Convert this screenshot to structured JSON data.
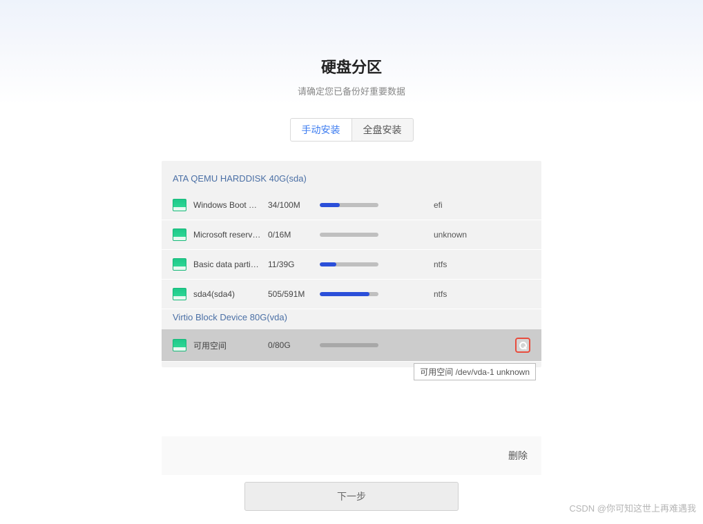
{
  "header": {
    "title": "硬盘分区",
    "subtitle": "请确定您已备份好重要数据"
  },
  "tabs": {
    "manual": "手动安装",
    "full": "全盘安装"
  },
  "disks": [
    {
      "label": "ATA  QEMU  HARDDISK  40G(sda)",
      "partitions": [
        {
          "name": "Windows Boot …",
          "size": "34/100M",
          "progress": 34,
          "fs": "efi"
        },
        {
          "name": "Microsoft reserv…",
          "size": "0/16M",
          "progress": 0,
          "fs": "unknown"
        },
        {
          "name": "Basic  data  parti…",
          "size": "11/39G",
          "progress": 28,
          "fs": "ntfs"
        },
        {
          "name": "sda4(sda4)",
          "size": "505/591M",
          "progress": 85,
          "fs": "ntfs"
        }
      ]
    },
    {
      "label": "Virtio  Block  Device  80G(vda)",
      "partitions": [
        {
          "name": "可用空间",
          "size": "0/80G",
          "progress": 0,
          "fs": "",
          "selected": true
        }
      ]
    }
  ],
  "tooltip": "可用空间   /dev/vda-1   unknown",
  "actions": {
    "delete": "删除",
    "next": "下一步"
  },
  "watermark": "CSDN @你可知这世上再难遇我"
}
